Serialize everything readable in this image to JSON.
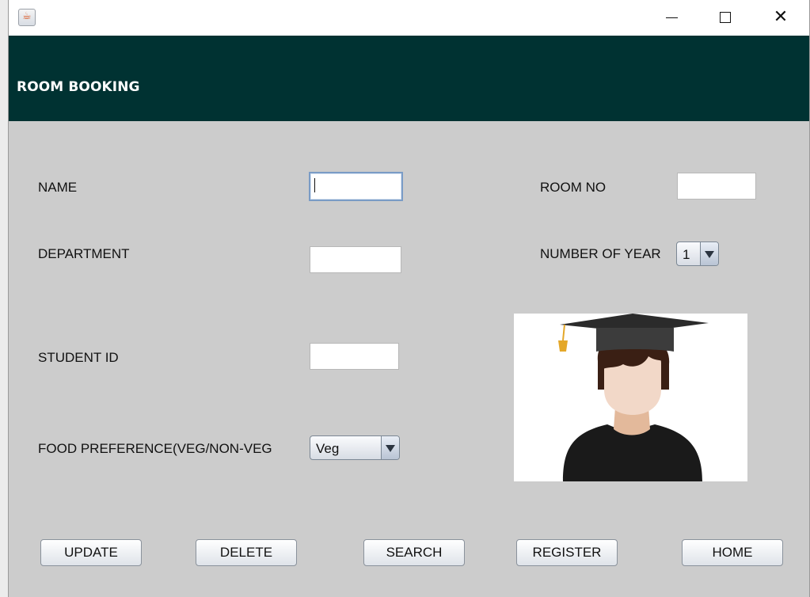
{
  "app": {
    "icon": "java-cup-icon",
    "window_controls": {
      "minimize": "minimize-icon",
      "maximize": "maximize-icon",
      "close": "close-icon"
    }
  },
  "header": {
    "title": "ROOM BOOKING",
    "background": "#003232"
  },
  "form": {
    "name_label": "NAME",
    "name_value": "",
    "department_label": "DEPARTMENT",
    "department_value": "",
    "student_id_label": "STUDENT ID",
    "student_id_value": "",
    "food_label": "FOOD PREFERENCE(VEG/NON-VEG",
    "food_selected": "Veg",
    "room_no_label": "ROOM NO",
    "room_no_value": "",
    "years_label": "NUMBER OF YEAR",
    "years_selected": "1"
  },
  "image": {
    "icon": "student-graduate-avatar-icon"
  },
  "buttons": {
    "update": "UPDATE",
    "delete": "DELETE",
    "search": "SEARCH",
    "register": "REGISTER",
    "home": "HOME"
  }
}
